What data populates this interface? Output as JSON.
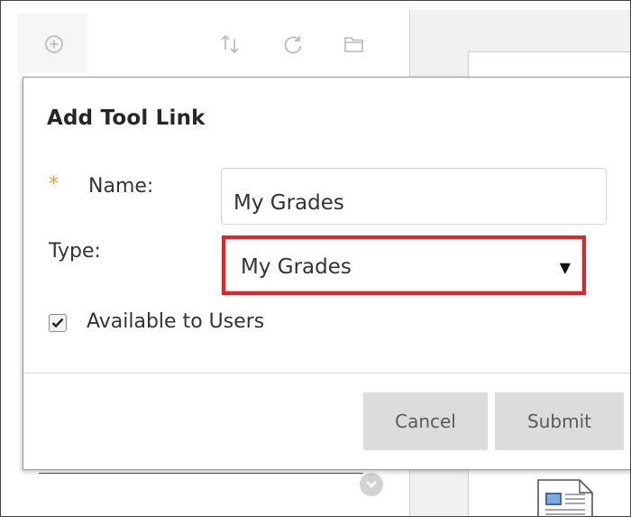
{
  "dialog": {
    "title": "Add Tool Link",
    "required_marker": "*",
    "name_label": "Name:",
    "name_value": "My Grades",
    "type_label": "Type:",
    "type_selected": "My Grades",
    "available_label": "Available to Users",
    "available_checked": true,
    "cancel_label": "Cancel",
    "submit_label": "Submit"
  },
  "toolbar": {
    "icons": [
      "add-circle-icon",
      "reorder-icon",
      "refresh-icon",
      "folder-icon"
    ]
  },
  "colors": {
    "required_star": "#f0a030",
    "highlight_border": "#e0242c",
    "button_bg": "#dcdcdc"
  }
}
